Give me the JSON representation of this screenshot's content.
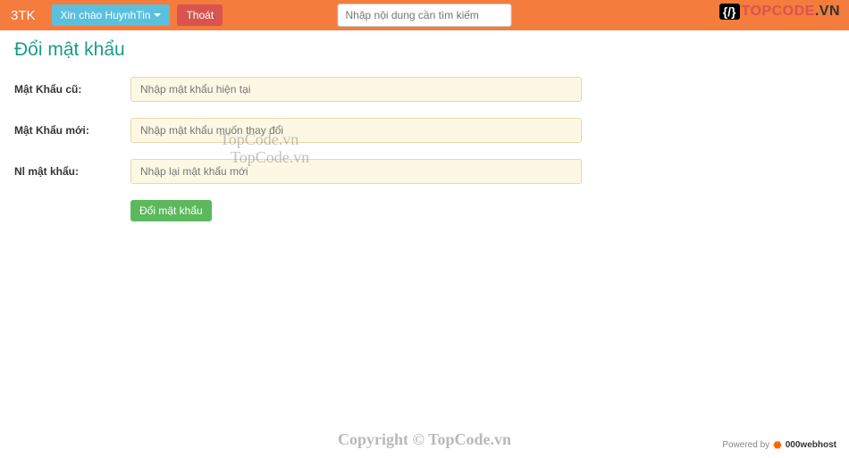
{
  "navbar": {
    "brand": "3TK",
    "greeting_label": "Xin chào HuynhTin",
    "logout_label": "Thoát",
    "search_placeholder": "Nhập nội dung cần tìm kiếm"
  },
  "logo": {
    "badge": "{/}",
    "text_main": "TOPCODE",
    "text_suffix": ".VN"
  },
  "page": {
    "title": "Đổi mật khẩu"
  },
  "form": {
    "old_pass": {
      "label": "Mật Khẩu cũ:",
      "placeholder": "Nhập mật khẩu hiện tại"
    },
    "new_pass": {
      "label": "Mật Khẩu mới:",
      "placeholder": "Nhập mật khẩu muốn thay đổi"
    },
    "confirm_pass": {
      "label": "Nl mật khẩu:",
      "placeholder": "Nhập lại mật khẩu mới"
    },
    "submit_label": "Đổi mật khẩu"
  },
  "watermarks": {
    "wm1": "TopCode.vn",
    "wm2": "TopCode.vn",
    "copyright": "Copyright © TopCode.vn"
  },
  "footer": {
    "powered_prefix": "Powered by",
    "host": "000webhost"
  }
}
